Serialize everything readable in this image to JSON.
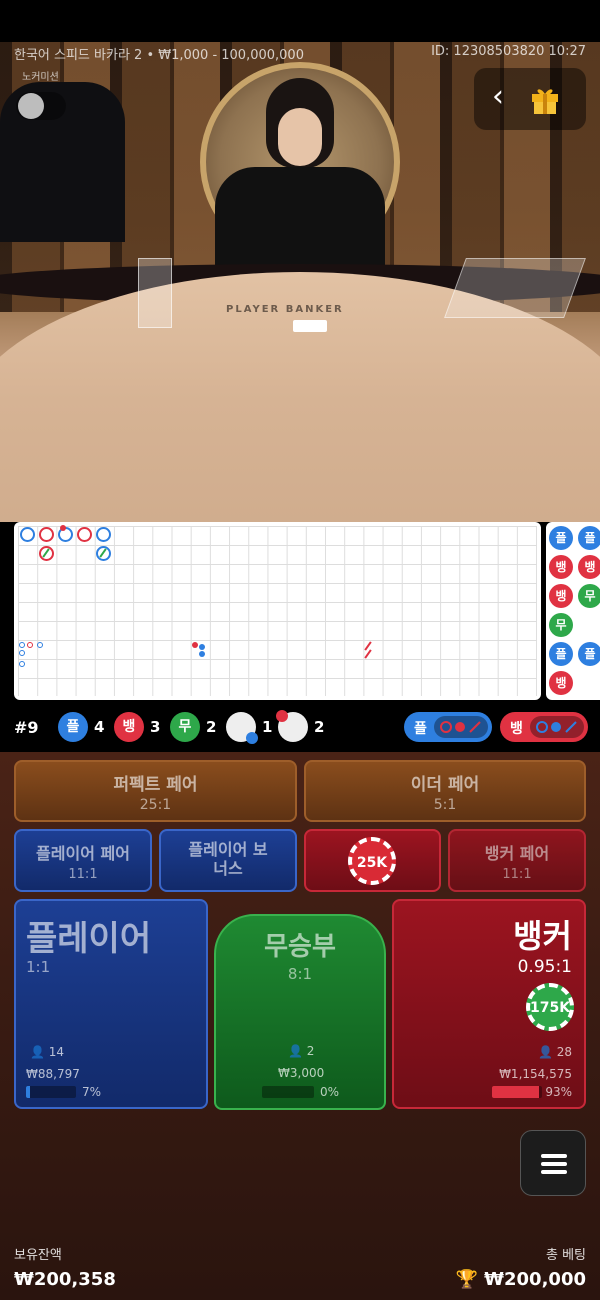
{
  "header": {
    "table_info": "한국어 스피드 바카라 2 • ₩1,000 - 100,000,000",
    "game_id": "ID: 12308503820 10:27",
    "sub_label": "노커미션"
  },
  "video": {
    "table_print": "PLAYER  BANKER"
  },
  "beadroad": {
    "items": [
      "플",
      "플",
      "뱅",
      "뱅",
      "뱅",
      "무",
      "무",
      "플",
      "플",
      "뱅"
    ]
  },
  "stats": {
    "round": "#9",
    "player_label": "플",
    "player_count": "4",
    "banker_label": "뱅",
    "banker_count": "3",
    "tie_label": "무",
    "tie_count": "2",
    "player_pair_count": "1",
    "banker_pair_count": "2",
    "player_ask": "플",
    "banker_ask": "뱅"
  },
  "bets": {
    "perfect_pair": {
      "label": "퍼펙트 페어",
      "odds": "25:1"
    },
    "either_pair": {
      "label": "이더 페어",
      "odds": "5:1"
    },
    "player_pair": {
      "label": "플레이어 페어",
      "odds": "11:1"
    },
    "player_bonus": {
      "label": "플레이어 보너스"
    },
    "banker_pair": {
      "label": "뱅커 페어",
      "odds": "11:1"
    },
    "player": {
      "label": "플레이어",
      "odds": "1:1",
      "bettors": "14",
      "amount": "₩88,797",
      "percent_label": "7%",
      "percent": 7
    },
    "tie": {
      "label": "무승부",
      "odds": "8:1",
      "bettors": "2",
      "amount": "₩3,000",
      "percent_label": "0%",
      "percent": 0
    },
    "banker": {
      "label": "뱅커",
      "odds": "0.95:1",
      "bettors": "28",
      "amount": "₩1,154,575",
      "percent_label": "93%",
      "percent": 93
    },
    "chip_bonus": "25K",
    "chip_banker": "175K"
  },
  "footer": {
    "balance_label": "보유잔액",
    "balance": "₩200,358",
    "total_bet_label": "총 베팅",
    "total_bet": "₩200,000"
  },
  "colors": {
    "player": "#2e7fe0",
    "banker": "#e03242",
    "tie": "#2ea84a"
  }
}
